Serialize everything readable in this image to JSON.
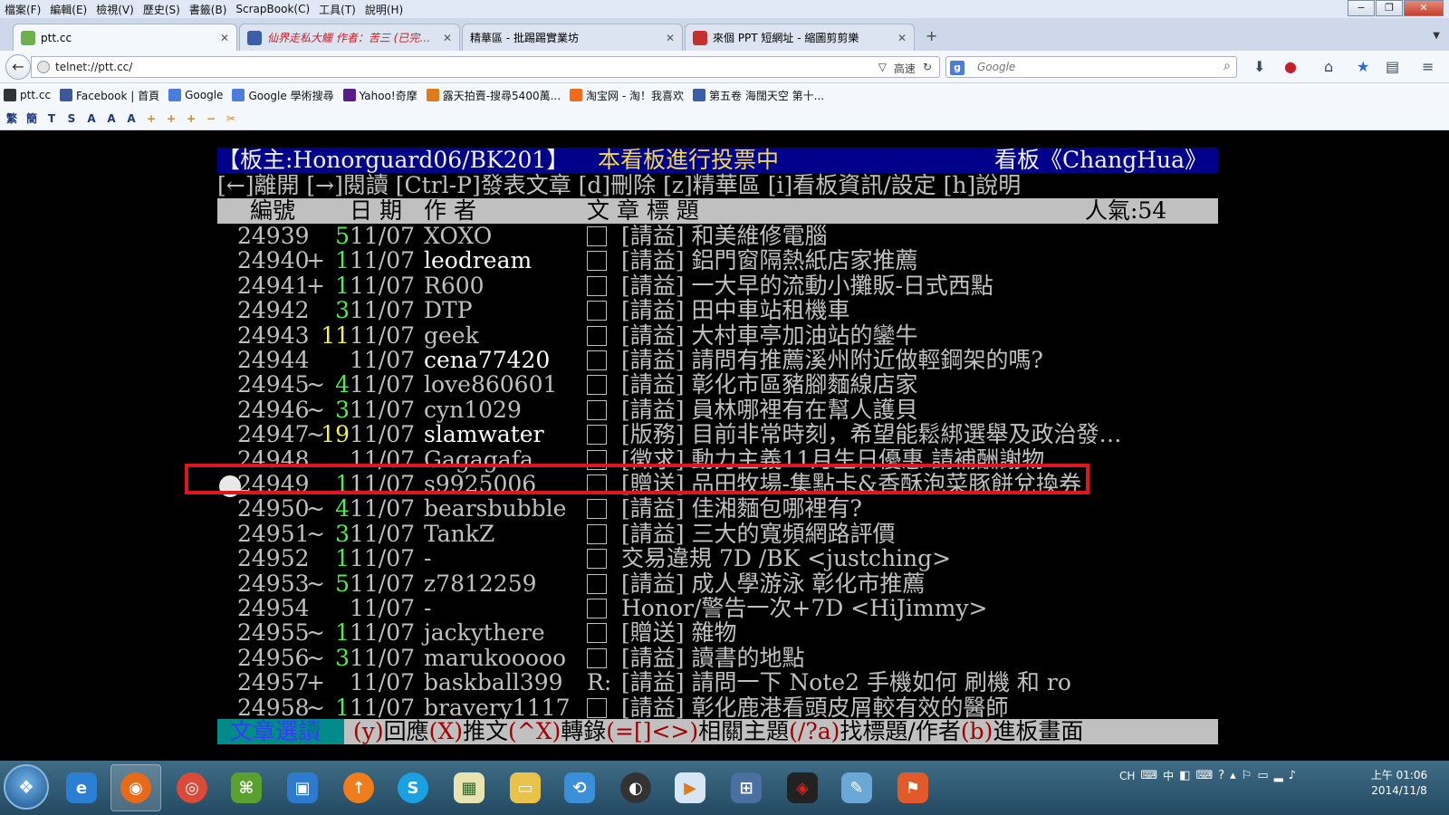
{
  "menu": [
    "檔案(F)",
    "編輯(E)",
    "檢視(V)",
    "歷史(S)",
    "書籤(B)",
    "ScrapBook(C)",
    "工具(T)",
    "說明(H)"
  ],
  "tabs": [
    {
      "title": "ptt.cc",
      "active": true
    },
    {
      "title": "仙界走私大鱷 作者：苦三 (已完成)...",
      "active": false
    },
    {
      "title": "精華區 - 批踢踢實業坊",
      "active": false
    },
    {
      "title": "來個 PPT 短網址 - 縮圖剪剪樂",
      "active": false
    }
  ],
  "new_tab": "+",
  "url": "telnet://ptt.cc/",
  "url_speed": "高速",
  "search_placeholder": "Google",
  "bookmarks": [
    "ptt.cc",
    "Facebook | 首頁",
    "Google",
    "Google 學術搜尋",
    "Yahoo!奇摩",
    "露天拍賣-搜尋5400萬...",
    "淘宝网 - 淘！我喜欢",
    "第五卷 海闊天空 第十..."
  ],
  "toolsbar": [
    "繁",
    "簡",
    "T",
    "S",
    "A",
    "A",
    "A",
    "+",
    "+",
    "+",
    "−",
    "✂"
  ],
  "terminal": {
    "board_moderators": "【板主:Honorguard06/BK201】",
    "board_vote": "本看板進行投票中",
    "board_name": "看板《ChangHua》",
    "key_help": "[←]離開 [→]閱讀 [Ctrl-P]發表文章 [d]刪除 [z]精華區 [i]看板資訊/設定 [h]說明",
    "col_num": "編號",
    "col_date": "日 期",
    "col_author": "作  者",
    "col_title": "文  章  標  題",
    "popularity": "人氣:54",
    "posts": [
      {
        "num": "24939",
        "mark": "",
        "recommend": "5",
        "rec_color": "green",
        "date": "11/07",
        "author": "XOXO",
        "bright": false,
        "reply": "",
        "title": "[請益] 和美維修電腦"
      },
      {
        "num": "24940",
        "mark": "+",
        "recommend": "1",
        "rec_color": "green",
        "date": "11/07",
        "author": "leodream",
        "bright": true,
        "reply": "",
        "title": "[請益] 鋁門窗隔熱紙店家推薦"
      },
      {
        "num": "24941",
        "mark": "+",
        "recommend": "1",
        "rec_color": "green",
        "date": "11/07",
        "author": "R600",
        "bright": false,
        "reply": "",
        "title": "[請益] 一大早的流動小攤販-日式西點"
      },
      {
        "num": "24942",
        "mark": "",
        "recommend": "3",
        "rec_color": "green",
        "date": "11/07",
        "author": "DTP",
        "bright": false,
        "reply": "",
        "title": "[請益] 田中車站租機車"
      },
      {
        "num": "24943",
        "mark": "",
        "recommend": "11",
        "rec_color": "yellow",
        "date": "11/07",
        "author": "geek",
        "bright": false,
        "reply": "",
        "title": "[請益] 大村車亭加油站的鑾牛"
      },
      {
        "num": "24944",
        "mark": "",
        "recommend": "",
        "rec_color": "green",
        "date": "11/07",
        "author": "cena77420",
        "bright": true,
        "reply": "",
        "title": "[請益] 請問有推薦溪州附近做輕鋼架的嗎?"
      },
      {
        "num": "24945",
        "mark": "~",
        "recommend": "4",
        "rec_color": "green",
        "date": "11/07",
        "author": "love860601",
        "bright": false,
        "reply": "",
        "title": "[請益] 彰化市區豬腳麵線店家"
      },
      {
        "num": "24946",
        "mark": "~",
        "recommend": "3",
        "rec_color": "green",
        "date": "11/07",
        "author": "cyn1029",
        "bright": false,
        "reply": "",
        "title": "[請益] 員林哪裡有在幫人護貝"
      },
      {
        "num": "24947",
        "mark": "~",
        "recommend": "19",
        "rec_color": "yellow",
        "date": "11/07",
        "author": "slamwater",
        "bright": true,
        "reply": "",
        "title": "[版務] 目前非常時刻，希望能鬆綁選舉及政治發…"
      },
      {
        "num": "24948",
        "mark": "",
        "recommend": "",
        "rec_color": "green",
        "date": "11/07",
        "author": "Gagagafa",
        "bright": false,
        "reply": "",
        "title": "[徵求] 動力主義11月生日優惠        請補酬謝物"
      },
      {
        "num": "24949",
        "mark": "",
        "recommend": "1",
        "rec_color": "green",
        "date": "11/07",
        "author": "s9925006",
        "bright": false,
        "reply": "",
        "title": "[贈送] 品田牧場-集點卡&香酥泡菜豚餅兌換券"
      },
      {
        "num": "24950",
        "mark": "~",
        "recommend": "4",
        "rec_color": "green",
        "date": "11/07",
        "author": "bearsbubble",
        "bright": false,
        "reply": "",
        "title": "[請益] 佳湘麵包哪裡有?"
      },
      {
        "num": "24951",
        "mark": "~",
        "recommend": "3",
        "rec_color": "green",
        "date": "11/07",
        "author": "TankZ",
        "bright": false,
        "reply": "",
        "title": "[請益] 三大的寬頻網路評價"
      },
      {
        "num": "24952",
        "mark": "",
        "recommend": "1",
        "rec_color": "green",
        "date": "11/07",
        "author": "-",
        "bright": false,
        "reply": "",
        "title": "交易違規 7D  /BK <justching>"
      },
      {
        "num": "24953",
        "mark": "~",
        "recommend": "5",
        "rec_color": "green",
        "date": "11/07",
        "author": "z7812259",
        "bright": false,
        "reply": "",
        "title": "[請益] 成人學游泳 彰化市推薦"
      },
      {
        "num": "24954",
        "mark": "",
        "recommend": "",
        "rec_color": "green",
        "date": "11/07",
        "author": "-",
        "bright": false,
        "reply": "",
        "title": "Honor/警告一次+7D <HiJimmy>"
      },
      {
        "num": "24955",
        "mark": "~",
        "recommend": "1",
        "rec_color": "green",
        "date": "11/07",
        "author": "jackythere",
        "bright": false,
        "reply": "",
        "title": "[贈送] 雜物"
      },
      {
        "num": "24956",
        "mark": "~",
        "recommend": "3",
        "rec_color": "green",
        "date": "11/07",
        "author": "marukooooo",
        "bright": false,
        "reply": "",
        "title": "[請益] 讀書的地點"
      },
      {
        "num": "24957",
        "mark": "+",
        "recommend": "",
        "rec_color": "green",
        "date": "11/07",
        "author": "baskball399",
        "bright": false,
        "reply": "R:",
        "title": "[請益] 請問一下 Note2 手機如何 刷機 和 ro"
      },
      {
        "num": "24958",
        "mark": "~",
        "recommend": "1",
        "rec_color": "green",
        "date": "11/07",
        "author": "bravery1117",
        "bright": false,
        "reply": "",
        "title": "[請益] 彰化鹿港看頭皮屑較有效的醫師"
      }
    ],
    "status_lead": "文章選讀",
    "status_items": [
      {
        "key": "(y)",
        "text": "回應"
      },
      {
        "key": "(X)",
        "text": "推文"
      },
      {
        "key": "(^X)",
        "text": "轉錄"
      },
      {
        "key": "(=[]<>)",
        "text": "相關主題"
      },
      {
        "key": "(/?a)",
        "text": "找標題/作者"
      },
      {
        "key": "(b)",
        "text": "進板畫面"
      }
    ]
  },
  "tray": {
    "lang": "CH",
    "ime": "中"
  },
  "clock": {
    "time": "上午 01:06",
    "date": "2014/11/8"
  },
  "colors": {
    "board_bg": "#00008b",
    "vote_text": "#f3d84a",
    "recommend_green": "#4cf04c",
    "recommend_yellow": "#f2f24a",
    "highlight": "#e0161f",
    "status_lead_bg": "#008b8b"
  }
}
